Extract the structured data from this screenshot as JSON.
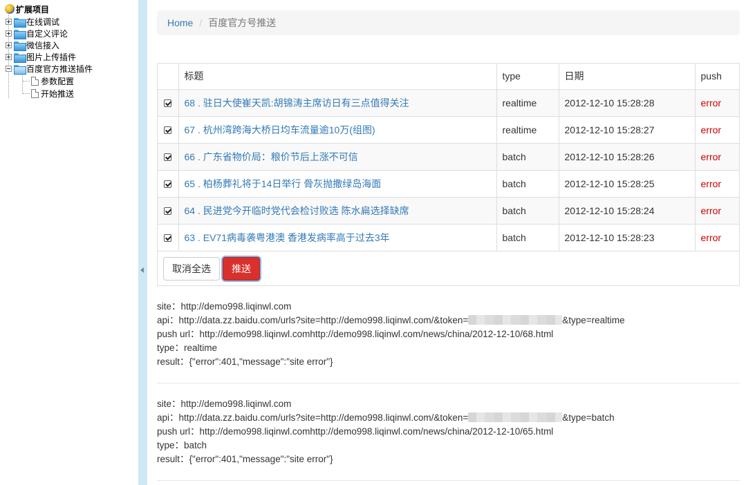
{
  "tree": {
    "root": "扩展项目",
    "items": [
      {
        "label": "在线调试",
        "expanded": false
      },
      {
        "label": "自定义评论",
        "expanded": false
      },
      {
        "label": "微信接入",
        "expanded": false
      },
      {
        "label": "图片上传插件",
        "expanded": false
      },
      {
        "label": "百度官方推送插件",
        "expanded": true
      }
    ],
    "children": [
      "参数配置",
      "开始推送"
    ]
  },
  "breadcrumb": {
    "home": "Home",
    "separator": "/",
    "current": "百度官方号推送"
  },
  "table": {
    "headers": {
      "title": "标题",
      "type": "type",
      "date": "日期",
      "push": "push"
    },
    "rows": [
      {
        "title": "68 . 驻日大使崔天凯:胡锦涛主席访日有三点值得关注",
        "type": "realtime",
        "date": "2012-12-10 15:28:28",
        "push": "error"
      },
      {
        "title": "67 . 杭州湾跨海大桥日均车流量逾10万(组图)",
        "type": "realtime",
        "date": "2012-12-10 15:28:27",
        "push": "error"
      },
      {
        "title": "66 . 广东省物价局：粮价节后上涨不可信",
        "type": "batch",
        "date": "2012-12-10 15:28:26",
        "push": "error"
      },
      {
        "title": "65 . 柏杨葬礼将于14日举行 骨灰抛撒绿岛海面",
        "type": "batch",
        "date": "2012-12-10 15:28:25",
        "push": "error"
      },
      {
        "title": "64 . 民进党今开临时党代会检讨败选 陈水扁选择缺席",
        "type": "batch",
        "date": "2012-12-10 15:28:24",
        "push": "error"
      },
      {
        "title": "63 . EV71病毒袭粤港澳 香港发病率高于过去3年",
        "type": "batch",
        "date": "2012-12-10 15:28:23",
        "push": "error"
      }
    ]
  },
  "buttons": {
    "deselect_all": "取消全选",
    "push": "推送"
  },
  "logs": [
    {
      "site": "site：http://demo998.liqinwl.com",
      "api_prefix": "api：http://data.zz.baidu.com/urls?site=http://demo998.liqinwl.com/&token=",
      "api_suffix": "&type=realtime",
      "push_url": "push url：http://demo998.liqinwl.comhttp://demo998.liqinwl.com/news/china/2012-12-10/68.html",
      "type": "type：realtime",
      "result": "result：{\"error\":401,\"message\":\"site error\"}"
    },
    {
      "site": "site：http://demo998.liqinwl.com",
      "api_prefix": "api：http://data.zz.baidu.com/urls?site=http://demo998.liqinwl.com/&token=",
      "api_suffix": "&type=batch",
      "push_url": "push url：http://demo998.liqinwl.comhttp://demo998.liqinwl.com/news/china/2012-12-10/65.html",
      "type": "type：batch",
      "result": "result：{\"error\":401,\"message\":\"site error\"}"
    }
  ],
  "colors": {
    "link": "#337ab7",
    "error": "#cc0000",
    "danger_button": "#d9302c",
    "splitter": "#cfe8f6"
  }
}
